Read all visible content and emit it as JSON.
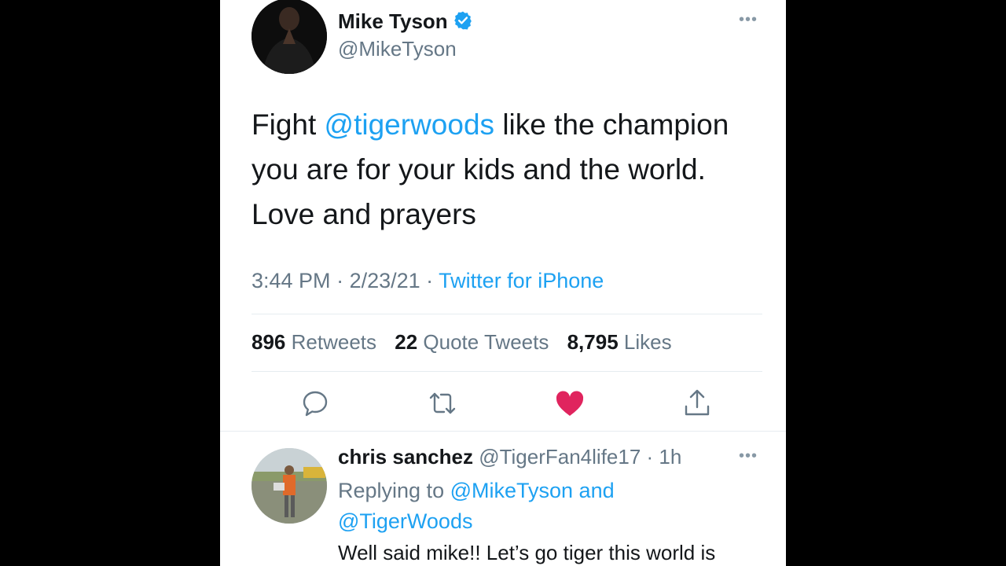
{
  "tweet": {
    "author_name": "Mike Tyson",
    "author_handle": "@MikeTyson",
    "more_icon": "more-horizontal-icon",
    "text_before": "Fight ",
    "mention": "@tigerwoods",
    "text_after": " like the champion\nyou are for your kids and the world.\nLove and prayers",
    "time": "3:44 PM",
    "date": "2/23/21",
    "separator": " · ",
    "source": "Twitter for iPhone",
    "retweets_count": "896",
    "retweets_label": "Retweets",
    "quotes_count": "22",
    "quotes_label": "Quote Tweets",
    "likes_count": "8,795",
    "likes_label": "Likes",
    "liked": true
  },
  "actions": [
    {
      "name": "reply-icon"
    },
    {
      "name": "retweet-icon"
    },
    {
      "name": "like-heart-icon",
      "color": "#e0245e"
    },
    {
      "name": "share-icon"
    }
  ],
  "colors": {
    "accent": "#1da1f2",
    "like": "#e0245e",
    "secondary_text": "#657786",
    "primary_text": "#14171a"
  },
  "reply": {
    "author_name": "chris sanchez",
    "author_handle": "@TigerFan4life17",
    "time": "1h",
    "replying_prefix": "Replying to ",
    "replying_to_1": "@MikeTyson",
    "replying_and": " and",
    "replying_to_2": "@TigerWoods",
    "text": "Well said mike!! Let’s go tiger this world is"
  }
}
